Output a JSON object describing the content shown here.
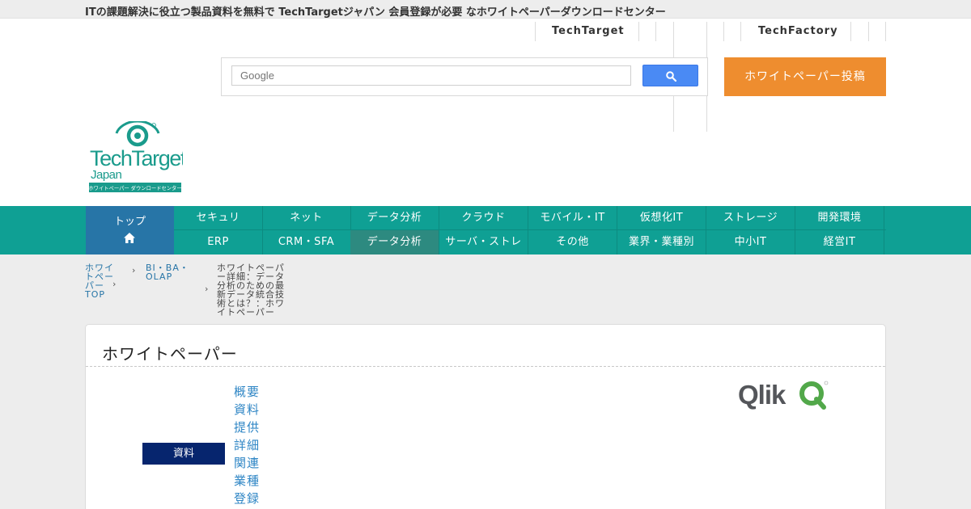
{
  "topbar": {
    "text": "ITの課題解決に役立つ製品資料を無料で TechTargetジャパン 会員登録が必要 なホワイトペーパーダウンロードセンター"
  },
  "header": {
    "links": {
      "techtarget": "TechTarget",
      "techfactory": "TechFactory"
    },
    "search": {
      "placeholder": "Google"
    },
    "cta_button": "ホワイトペーパー投稿"
  },
  "logo": {
    "word1": "TechTarget",
    "word2": "Japan",
    "tagline": "ホワイトペーパー ダウンロードセンター"
  },
  "nav": {
    "home_label": "トップ",
    "row1": [
      "セキュリ",
      "ネット",
      "データ分析",
      "クラウド",
      "モバイル・IT",
      "仮想化IT",
      "ストレージ",
      "開発環境"
    ],
    "row2": [
      "ERP",
      "CRM・SFA",
      "データ分析",
      "サーバ・ストレ",
      "その他",
      "業界・業種別",
      "中小IT",
      "経営IT"
    ],
    "active_row2_index": 2
  },
  "breadcrumb": {
    "home": [
      "ホワイ",
      "トペー",
      "パー",
      "TOP"
    ],
    "category": [
      "BI・BA・",
      "OLAP"
    ],
    "current": [
      "ホワイトペーパ",
      "ー詳細：データ",
      "分析のための最",
      "新データ統合技",
      "術とは？：ホワ",
      "イトペーパー"
    ]
  },
  "panel": {
    "title": "ホワイトペーパー",
    "button": "資料",
    "side_links": [
      "概要",
      "資料",
      "提供",
      "詳細",
      "関連",
      "業種",
      "登録"
    ],
    "vendor_logo_text": "Qlik"
  },
  "colors": {
    "nav": "#0fa094",
    "nav_home": "#2775a7",
    "cta": "#ee8d2f",
    "brand_green": "#1a9b8c",
    "button_navy": "#06256e"
  }
}
